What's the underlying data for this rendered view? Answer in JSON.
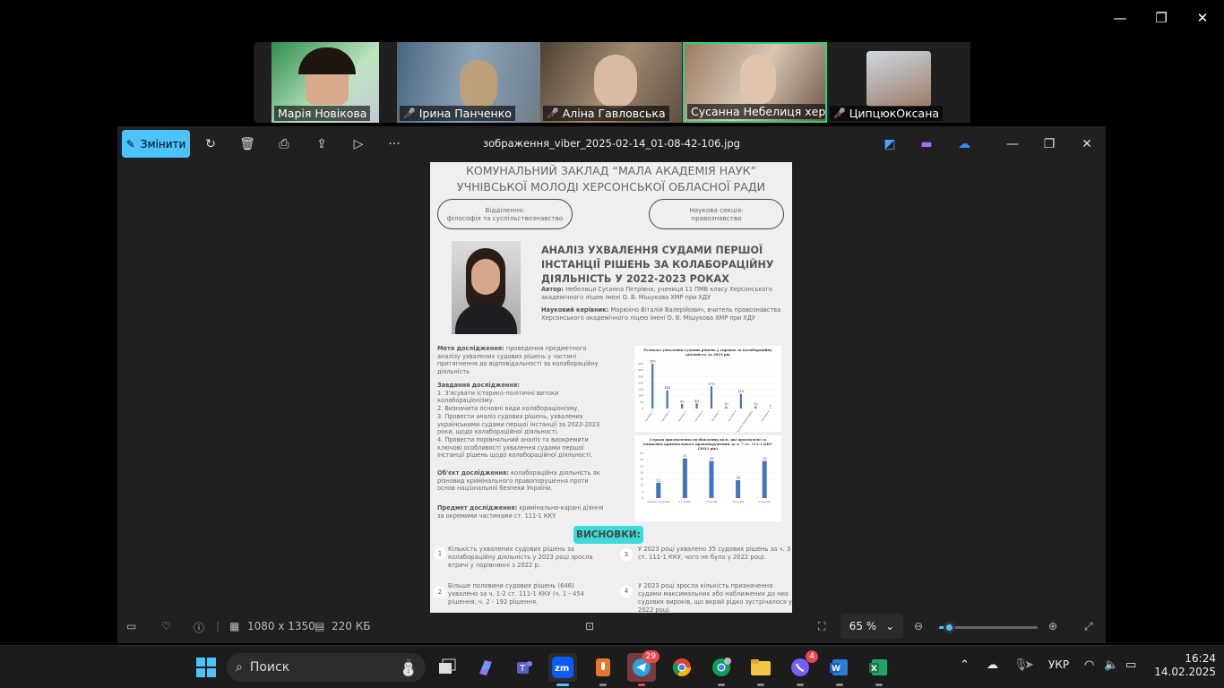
{
  "zoom_window": {
    "controls": [
      "minimize",
      "restore",
      "close"
    ]
  },
  "participants": [
    {
      "name": "Марія Новікова",
      "muted": false
    },
    {
      "name": "Ірина Панченко",
      "muted": true
    },
    {
      "name": "Аліна Гавловська",
      "muted": true
    },
    {
      "name": "Сусанна Небелиця херс...",
      "muted": false,
      "active": true
    },
    {
      "name": "ЦипцюкОксана",
      "muted": true
    }
  ],
  "viewer": {
    "edit_label": "Змінити",
    "filename": "зображення_viber_2025-02-14_01-08-42-106.jpg",
    "dimensions": "1080 x 1350",
    "size": "220 КБ",
    "zoom": "65 %",
    "zoom_fraction": 0.1
  },
  "doc": {
    "header1": "КОМУНАЛЬНИЙ ЗАКЛАД “МАЛА АКАДЕМІЯ НАУК”",
    "header2": "УЧНІВСЬКОЇ МОЛОДІ ХЕРСОНСЬКОЇ ОБЛАСНОЇ РАДИ",
    "dept_label": "Відділення:",
    "dept_value": "філософія та суспільствознавство",
    "section_label": "Наукова секція:",
    "section_value": "правознавство",
    "title": "АНАЛІЗ УХВАЛЕННЯ СУДАМИ ПЕРШОЇ ІНСТАНЦІЇ РІШЕНЬ ЗА КОЛАБОРАЦІЙНУ ДІЯЛЬНІСТЬ У 2022-2023 РОКАХ",
    "author_label": "Автор:",
    "author": "Небелиця Сусанна Петрівна, учениця 11 ПМВ класу Херсонського академічного ліцею імені О. В. Мішукова ХМР при ХДУ",
    "supervisor_label": "Науковий керівник:",
    "supervisor": "Марюхно Віталій Валерійович, вчитель правознавства Херсонського академічного ліцею імені О. В. Мішукова ХМР при ХДУ",
    "aim_label": "Мета дослідження:",
    "aim": "проведення предметного аналізу ухвалених судових рішень у частині притягнення до відповідальності за колабораційну діяльність",
    "tasks_label": "Завдання дослідження:",
    "tasks": [
      "1. З'ясувати історико-політичні витоки колабораціонізму.",
      "2. Визначити основні види колабораціонізму.",
      "3. Провести аналіз судових рішень, ухвалених українськими судами першої інстанції за 2022-2023 роки, щодо колабораційної діяльності.",
      "4. Провести порівняльний аналіз та виокремити ключові особливості ухвалення судами першої інстанції рішень щодо колабораційної діяльності."
    ],
    "object_label": "Об'єкт дослідження:",
    "object": "колабораційна діяльність як різновид кримінального правопорушення проти основ національної безпеки України.",
    "subject_label": "Предмет дослідження:",
    "subject": "кримінально-карані діяння за окремими частинами ст. 111-1 ККУ",
    "conclusions_label": "ВИСНОВКИ:",
    "conclusions": [
      {
        "n": "1",
        "text": "Кількість ухвалених судових рішень за колабораційну діяльність у 2023 році зросла втричі у порівнянні з 2022 р."
      },
      {
        "n": "2",
        "text": "Більше половини судових рішень (646) ухвалено за ч. 1-2 ст. 111-1 ККУ (ч. 1 - 454 рішення, ч. 2 - 192 рішення."
      },
      {
        "n": "3",
        "text": "У 2023 році ухвалено 35 судових рішень за ч. 3 ст. 111-1 ККУ, чого не було у 2022 році."
      },
      {
        "n": "4",
        "text": "У 2023 році зросла кількість призначення судами максимальних або наближених до них судових вироків, що вкрай рідко зустрічалося у 2022 році."
      }
    ]
  },
  "chart_data": [
    {
      "type": "bar",
      "title": "Розподіл ухвалення судових рішень у справах за колабораційну діяльність за 2023 рік",
      "categories": [
        "частина 1",
        "частина 2",
        "частина 3",
        "частина 4",
        "частина 5",
        "частина 6",
        "добровольче формування",
        "частина 8"
      ],
      "values": [
        350,
        142,
        35,
        40,
        173,
        13,
        115,
        15,
        2
      ],
      "ylim": [
        0,
        350
      ],
      "yticks": [
        "350",
        "300",
        "250",
        "200",
        "150",
        "100",
        "50",
        "0"
      ]
    },
    {
      "type": "bar",
      "title": "Строки призначення позбавлення волі, які призначені за вчинення кримінального правопорушення за ч. 7 ст. 111-1 ККУ (2023 рік)",
      "categories": [
        "менше 12 років",
        "12 років",
        "13 років",
        "14 років",
        "15 років"
      ],
      "values": [
        12,
        31,
        29,
        14,
        29
      ],
      "ylim": [
        0,
        35
      ],
      "yticks": [
        "35",
        "30",
        "25",
        "20",
        "15",
        "10",
        "5",
        "0"
      ]
    }
  ],
  "taskbar": {
    "search_placeholder": "Поиск",
    "telegram_badge": "29",
    "viber_badge": "4",
    "language": "УКР",
    "time": "16:24",
    "date": "14.02.2025"
  }
}
